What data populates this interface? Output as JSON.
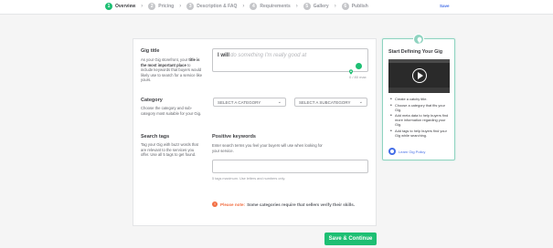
{
  "header": {
    "steps": [
      {
        "num": "1",
        "label": "Overview"
      },
      {
        "num": "2",
        "label": "Pricing"
      },
      {
        "num": "3",
        "label": "Description & FAQ"
      },
      {
        "num": "4",
        "label": "Requirements"
      },
      {
        "num": "5",
        "label": "Gallery"
      },
      {
        "num": "6",
        "label": "Publish"
      }
    ],
    "active_step": 1,
    "separator": "›",
    "save_label": "Save"
  },
  "form": {
    "gig_title": {
      "label": "Gig title",
      "desc_pre": "As your Gig storefront, your ",
      "desc_bold": "title is the most important place",
      "desc_post": " to include keywords that buyers would likely use to search for a service like yours.",
      "prefix": "I will",
      "placeholder": "do something I'm really good at",
      "counter": "0 / 80 max"
    },
    "category": {
      "label": "Category",
      "desc": "Choose the category and sub-category most suitable for your Gig.",
      "category_select": "SELECT A CATEGORY",
      "subcategory_select": "SELECT A SUBCATEGORY",
      "chevron": "⌄"
    },
    "search_tags": {
      "label": "Search tags",
      "desc": "Tag your Gig with buzz words that are relevant to the services you offer. Use all 5 tags to get found.",
      "positive_title": "Positive keywords",
      "positive_desc": "Enter search terms you feel your buyers will use when looking for your service.",
      "hint": "5 tags maximum. Use letters and numbers only."
    },
    "note": {
      "icon": "!",
      "strong": "Please note:",
      "text": "Some categories require that sellers verify their skills."
    }
  },
  "actions": {
    "save_continue": "Save & Continue"
  },
  "tips": {
    "title": "Start Defining Your Gig",
    "items": [
      "Create a catchy title.",
      "Choose a category that fits your Gig.",
      "Add meta data to help buyers find more information regarding your Gig.",
      "Add tags to help buyers find your Gig while searching."
    ],
    "link": "Learn Gig Policy"
  },
  "colors": {
    "brand_green": "#1dbf73",
    "accent_blue": "#446ee7",
    "warning_orange": "#f26f44",
    "tips_border": "#8fd3c0"
  },
  "icons": [
    "lightbulb-icon",
    "location-pin-icon",
    "grammarly-icon",
    "play-icon",
    "policy-icon",
    "warning-icon",
    "chevron-down-icon"
  ]
}
